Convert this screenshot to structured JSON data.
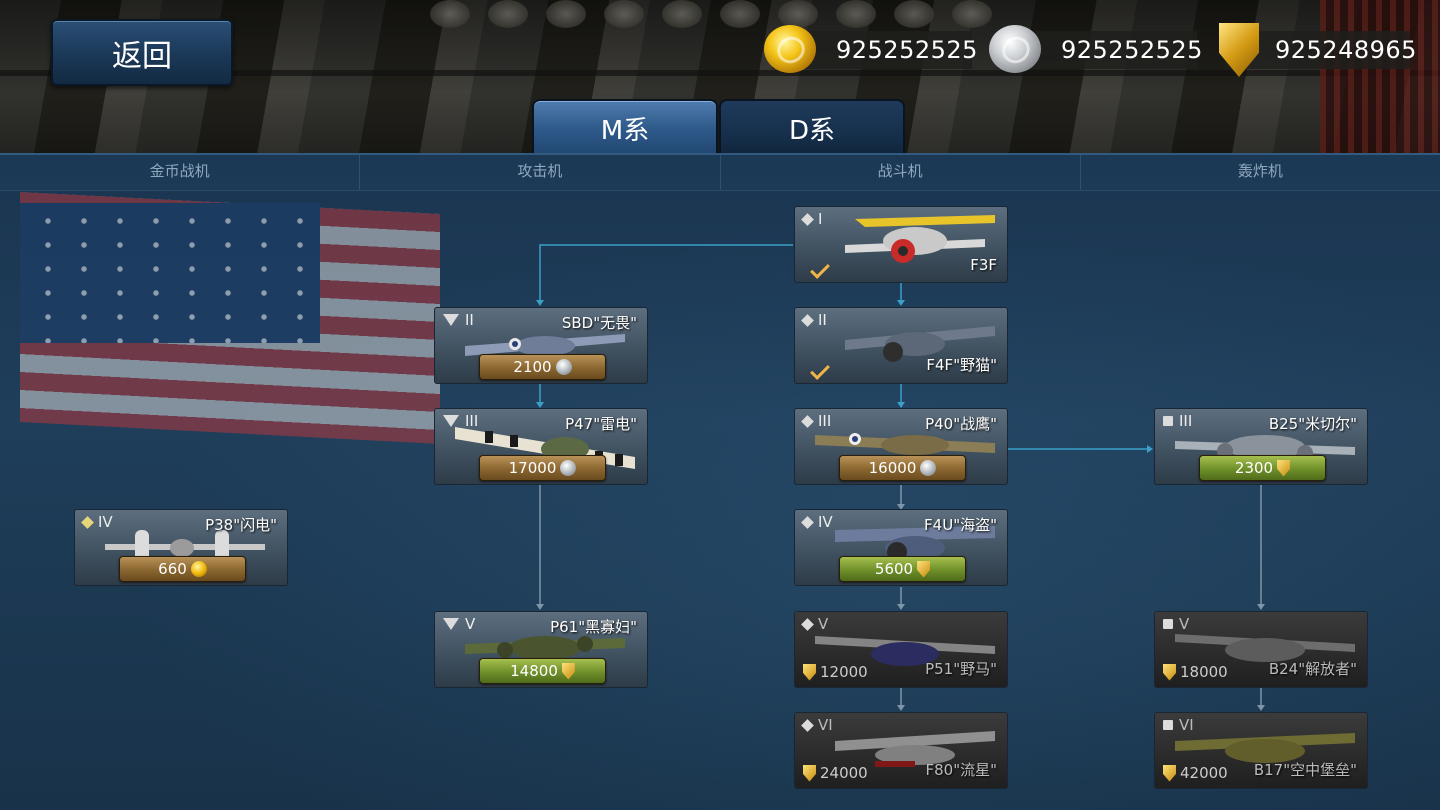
{
  "back_label": "返回",
  "currencies": {
    "gold": "925252525",
    "silver": "925252525",
    "medal": "925248965"
  },
  "tabs": [
    {
      "label": "M系",
      "active": true
    },
    {
      "label": "D系",
      "active": false
    }
  ],
  "categories": [
    "金币战机",
    "攻击机",
    "战斗机",
    "轰炸机"
  ],
  "planes": {
    "p38": {
      "tier": "IV",
      "name": "P38\"闪电\"",
      "price": "660",
      "currency": "gold-coin-icon"
    },
    "sbd": {
      "tier": "II",
      "name": "SBD\"无畏\"",
      "price": "2100",
      "currency": "silver-coin-icon"
    },
    "p47": {
      "tier": "III",
      "name": "P47\"雷电\"",
      "price": "17000",
      "currency": "silver-coin-icon"
    },
    "p61": {
      "tier": "V",
      "name": "P61\"黑寡妇\"",
      "price": "14800",
      "currency": "medal-icon"
    },
    "f3f": {
      "tier": "I",
      "name": "F3F",
      "owned": true
    },
    "f4f": {
      "tier": "II",
      "name": "F4F\"野猫\"",
      "owned": true
    },
    "p40": {
      "tier": "III",
      "name": "P40\"战鹰\"",
      "price": "16000",
      "currency": "silver-coin-icon"
    },
    "f4u": {
      "tier": "IV",
      "name": "F4U\"海盗\"",
      "price": "5600",
      "currency": "medal-icon"
    },
    "p51": {
      "tier": "V",
      "name": "P51\"野马\"",
      "price": "12000",
      "currency": "medal-icon",
      "locked": true
    },
    "f80": {
      "tier": "VI",
      "name": "F80\"流星\"",
      "price": "24000",
      "currency": "medal-icon",
      "locked": true
    },
    "b25": {
      "tier": "III",
      "name": "B25\"米切尔\"",
      "price": "2300",
      "currency": "medal-icon"
    },
    "b24": {
      "tier": "V",
      "name": "B24\"解放者\"",
      "price": "18000",
      "currency": "medal-icon",
      "locked": true
    },
    "b17": {
      "tier": "VI",
      "name": "B17\"空中堡垒\"",
      "price": "42000",
      "currency": "medal-icon",
      "locked": true
    }
  },
  "colors": {
    "accent_blue": "#2f5b8b",
    "price_brown": "#8a6630",
    "price_green": "#6f8f2a",
    "connector": "#3aa0c8",
    "owned_check": "#f0b449"
  }
}
